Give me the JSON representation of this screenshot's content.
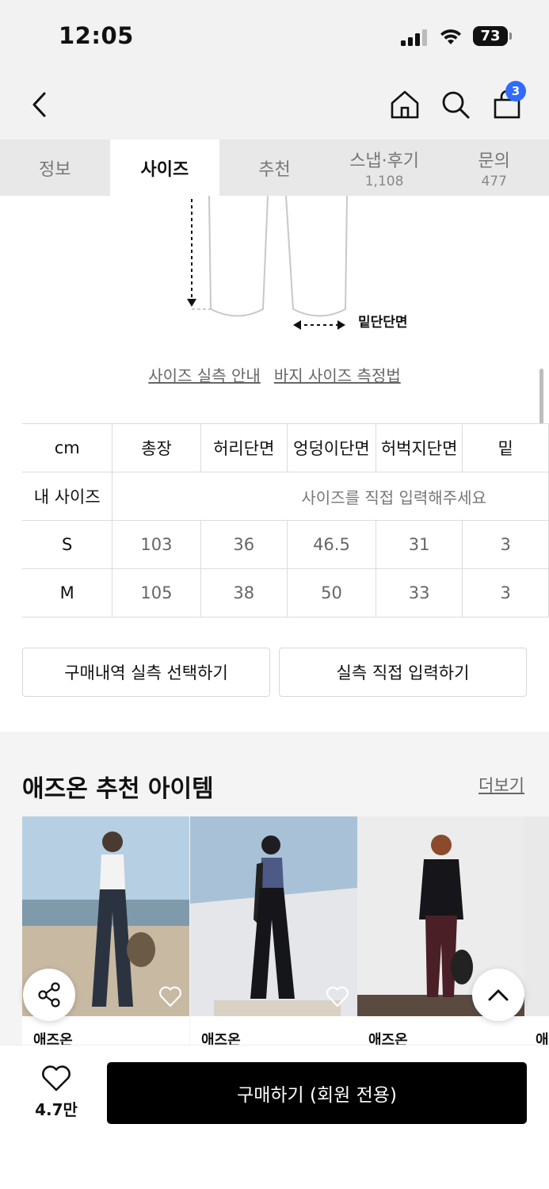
{
  "status_bar": {
    "time": "12:05",
    "battery": "73"
  },
  "header": {
    "cart_count": "3"
  },
  "tabs": [
    {
      "label": "정보",
      "count": ""
    },
    {
      "label": "사이즈",
      "count": ""
    },
    {
      "label": "추천",
      "count": ""
    },
    {
      "label": "스냅·후기",
      "count": "1,108"
    },
    {
      "label": "문의",
      "count": "477"
    }
  ],
  "diagram": {
    "label": "밑단단면"
  },
  "links": {
    "size_guide": "사이즈 실측 안내",
    "pants_measure": "바지 사이즈 측정법"
  },
  "size_table": {
    "unit": "cm",
    "columns": [
      "총장",
      "허리단면",
      "엉덩이단면",
      "허벅지단면",
      "밑"
    ],
    "my_size_label": "내 사이즈",
    "my_size_prompt": "사이즈를 직접 입력해주세요",
    "rows": [
      {
        "size": "S",
        "values": [
          "103",
          "36",
          "46.5",
          "31",
          "3"
        ]
      },
      {
        "size": "M",
        "values": [
          "105",
          "38",
          "50",
          "33",
          "3"
        ]
      }
    ]
  },
  "buttons": {
    "select_history": "구매내역 실측 선택하기",
    "direct_input": "실측 직접 입력하기"
  },
  "recommend": {
    "title": "애즈온 추천 아이템",
    "more": "더보기",
    "items": [
      {
        "brand": "애즈온"
      },
      {
        "brand": "애즈온"
      },
      {
        "brand": "애즈온"
      },
      {
        "brand": "애"
      }
    ]
  },
  "bottom": {
    "like_count": "4.7만",
    "buy_label": "구매하기 (회원 전용)"
  }
}
